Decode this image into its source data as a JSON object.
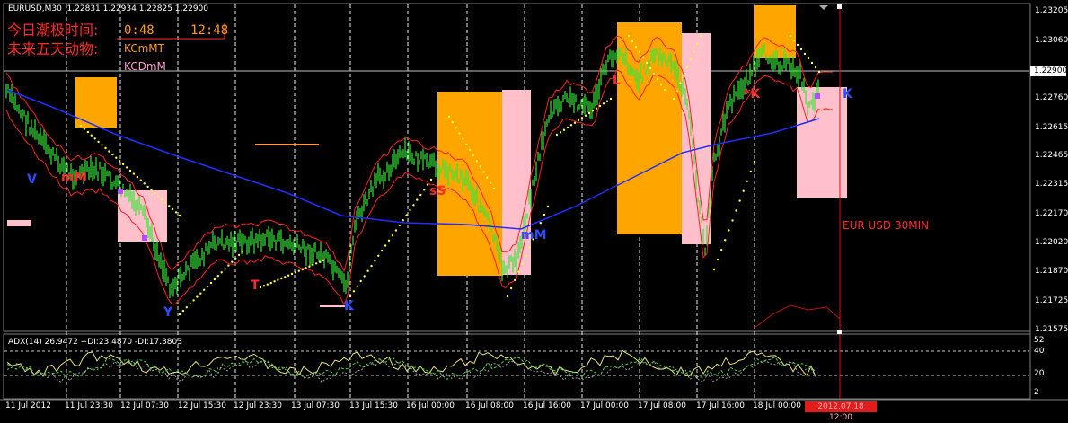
{
  "header": {
    "symbol_line": "EURUSD,M30  1.22831 1.22934 1.22825 1.22900"
  },
  "overlay": {
    "line1_label": "今日潮极时间:",
    "line1_value1": "0:48",
    "line1_value2": "12:48",
    "line2_label": "未来五天动物:",
    "line2_value": "KCmMT",
    "line3_value": "KCDmM"
  },
  "chart_note": "EUR USD 30MIN",
  "price_axis": {
    "labels": [
      "1.23205",
      "1.23060",
      "1.22760",
      "1.22615",
      "1.22465",
      "1.22315",
      "1.22170",
      "1.22020",
      "1.21870",
      "1.21725",
      "1.21575"
    ],
    "current": "1.22900"
  },
  "time_axis": {
    "labels": [
      "11 Jul 2012",
      "11 Jul 23:30",
      "12 Jul 07:30",
      "12 Jul 15:30",
      "12 Jul 23:30",
      "13 Jul 07:30",
      "13 Jul 15:30",
      "16 Jul 00:00",
      "16 Jul 08:00",
      "16 Jul 16:00",
      "17 Jul 00:00",
      "17 Jul 08:00",
      "17 Jul 16:00",
      "18 Jul 00:00"
    ],
    "highlight": "2012.07.18 12:00"
  },
  "adx": {
    "label": "ADX(14) 26.9472 +DI:23.4870 -DI:17.3803",
    "scale": [
      "52",
      "40",
      "20",
      "2"
    ]
  },
  "signals": [
    {
      "text": "V",
      "color": "#2a4dff"
    },
    {
      "text": "mM",
      "color": "#ff2a2a"
    },
    {
      "text": "Y",
      "color": "#2a4dff"
    },
    {
      "text": "T",
      "color": "#ff2a2a"
    },
    {
      "text": "K",
      "color": "#2a4dff"
    },
    {
      "text": "sS",
      "color": "#ff2a2a"
    },
    {
      "text": "mM",
      "color": "#2a4dff"
    },
    {
      "text": "L",
      "color": "#ff2a2a"
    },
    {
      "text": "*K",
      "color": "#ff2a2a"
    },
    {
      "text": "K",
      "color": "#2a4dff"
    }
  ],
  "colors": {
    "background": "#000000",
    "candles": "#39e639",
    "red_line": "#ff2020",
    "blue_line": "#1e2fff",
    "dots": "#ffff40",
    "orange_box": "#ffa500",
    "pink_box": "#ffc0cb",
    "grid": "#ffffff"
  }
}
